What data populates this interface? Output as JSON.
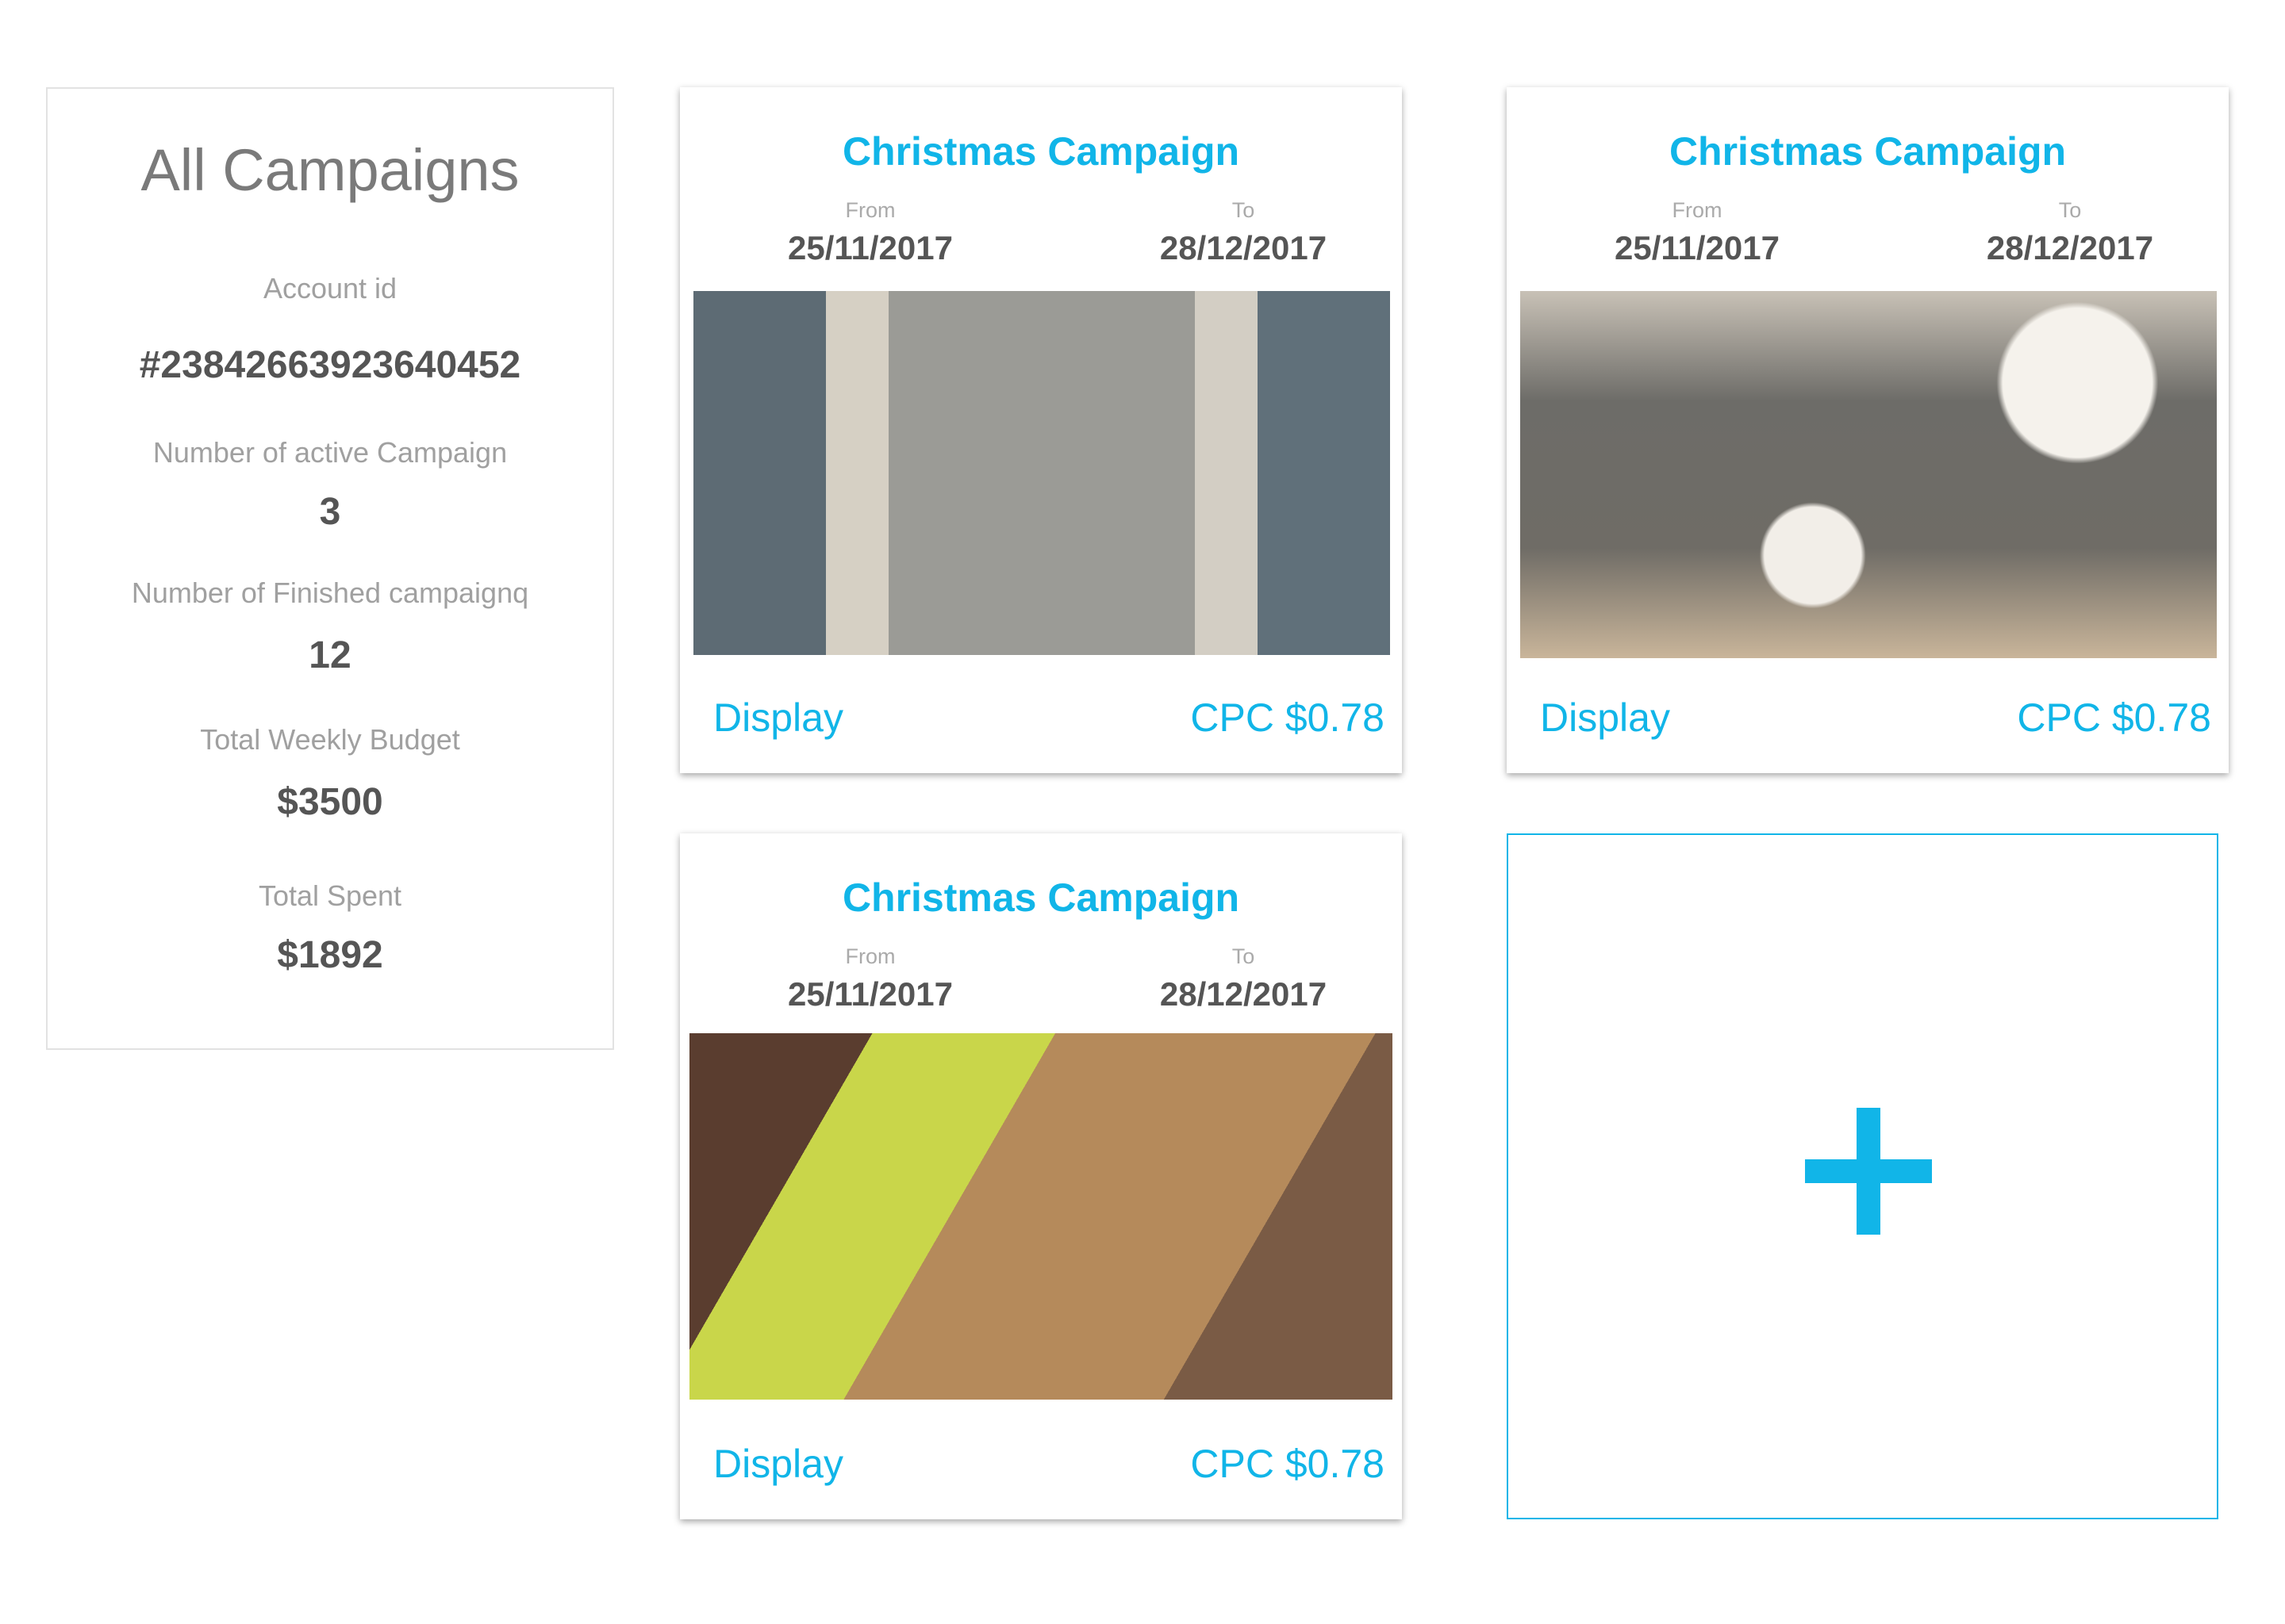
{
  "summary": {
    "title": "All Campaigns",
    "account_label": "Account id",
    "account_id": "#23842663923640452",
    "active_label": "Number of active Campaign",
    "active_value": "3",
    "finished_label": "Number of Finished campaignq",
    "finished_value": "12",
    "budget_label": "Total Weekly Budget",
    "budget_value": "$3500",
    "spent_label": "Total Spent",
    "spent_value": "$1892"
  },
  "campaigns": [
    {
      "title": "Christmas Campaign",
      "from_label": "From",
      "from": "25/11/2017",
      "to_label": "To",
      "to": "28/12/2017",
      "type": "Display",
      "cpc": "CPC $0.78"
    },
    {
      "title": "Christmas Campaign",
      "from_label": "From",
      "from": "25/11/2017",
      "to_label": "To",
      "to": "28/12/2017",
      "type": "Display",
      "cpc": "CPC $0.78"
    },
    {
      "title": "Christmas Campaign",
      "from_label": "From",
      "from": "25/11/2017",
      "to_label": "To",
      "to": "28/12/2017",
      "type": "Display",
      "cpc": "CPC $0.78"
    }
  ],
  "accent": "#11b5e8"
}
